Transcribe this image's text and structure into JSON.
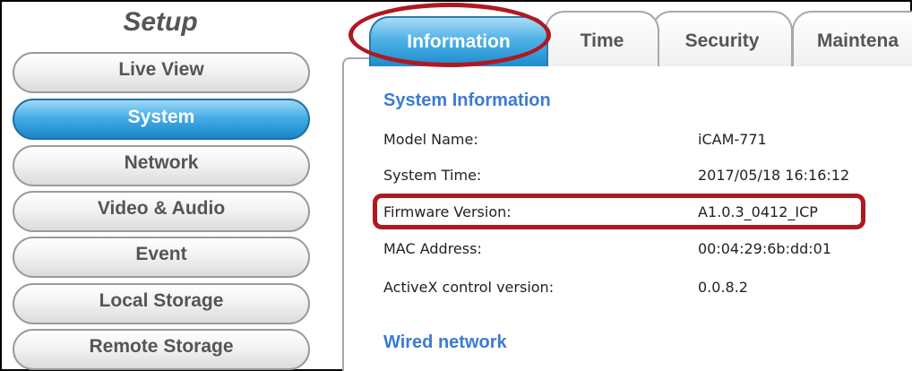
{
  "sidebar": {
    "title": "Setup",
    "items": [
      {
        "label": "Live View"
      },
      {
        "label": "System"
      },
      {
        "label": "Network"
      },
      {
        "label": "Video & Audio"
      },
      {
        "label": "Event"
      },
      {
        "label": "Local Storage"
      },
      {
        "label": "Remote Storage"
      }
    ],
    "active_item": "System"
  },
  "tabs": [
    {
      "label": "Information"
    },
    {
      "label": "Time"
    },
    {
      "label": "Security"
    },
    {
      "label": "Maintena"
    }
  ],
  "active_tab": "Information",
  "system_information": {
    "title": "System Information",
    "rows": [
      {
        "label": "Model Name:",
        "value": "iCAM-771"
      },
      {
        "label": "System Time:",
        "value": "2017/05/18 16:16:12"
      },
      {
        "label": "Firmware Version:",
        "value": "A1.0.3_0412_ICP"
      },
      {
        "label": "MAC Address:",
        "value": "00:04:29:6b:dd:01"
      },
      {
        "label": "ActiveX control version:",
        "value": "0.0.8.2"
      }
    ]
  },
  "wired_network": {
    "title": "Wired network"
  },
  "colors": {
    "accent_blue": "#3a7bd5",
    "active_tab_blue": "#4eb1e6",
    "annotation_red": "#b01820"
  }
}
